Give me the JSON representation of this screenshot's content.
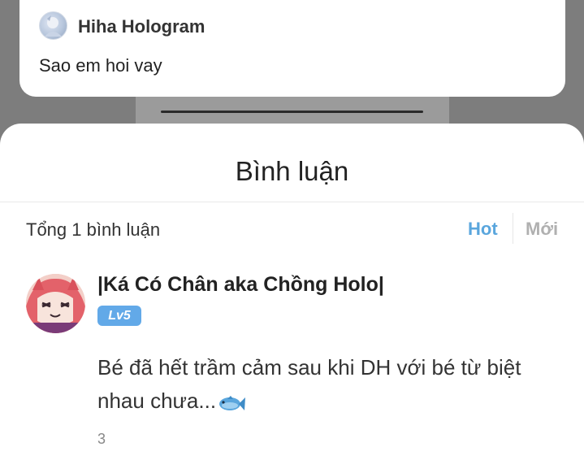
{
  "post": {
    "author": "Hiha Hologram",
    "text": "Sao em hoi vay"
  },
  "comments_sheet": {
    "title": "Bình luận",
    "total": "Tổng 1 bình luận",
    "sort": {
      "hot": "Hot",
      "new": "Mới",
      "active": "hot"
    }
  },
  "comment": {
    "author": "|Ká Có Chân aka Chồng Holo|",
    "level": "Lv5",
    "text": "Bé đã hết trầm cảm sau khi DH với bé từ biệt nhau chưa...",
    "likes": "3",
    "emoji": "fish-icon"
  },
  "colors": {
    "accent": "#5aa6dd",
    "badge": "#62a9e8",
    "inactive": "#b0b0b0"
  }
}
